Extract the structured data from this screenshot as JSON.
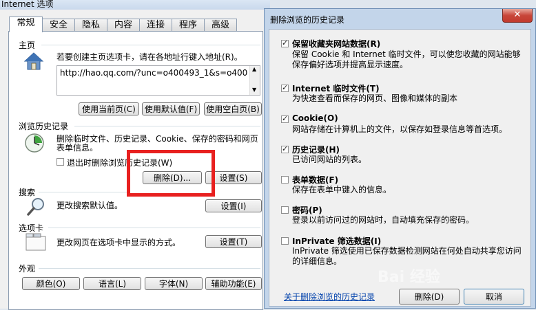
{
  "io_window": {
    "title": "Internet 选项",
    "tabs": [
      "常规",
      "安全",
      "隐私",
      "内容",
      "连接",
      "程序",
      "高级"
    ],
    "homepage": {
      "section": "主页",
      "instruction": "若要创建主页选项卡，请在各地址行键入地址(R)。",
      "url": "http://hao.qq.com/?unc=o400493_1&s=o40049",
      "buttons": [
        "使用当前页(C)",
        "使用默认值(F)",
        "使用空白页(B)"
      ]
    },
    "history": {
      "section": "浏览历史记录",
      "description_line1": "删除临时文件、历史记录、Cookie、保存的密码和网页",
      "description_line2": "表单信息。",
      "checkbox_label": "退出时删除浏览历史记录(W)",
      "delete_button": "删除(D)...",
      "settings_button": "设置(S)"
    },
    "search": {
      "section": "搜索",
      "description": "更改搜索默认值。",
      "settings_button": "设置(I)"
    },
    "tabs_section": {
      "section": "选项卡",
      "description": "更改网页在选项卡中显示的方式。",
      "settings_button": "设置(T)"
    },
    "appearance": {
      "section": "外观",
      "buttons": [
        "颜色(O)",
        "语言(L)",
        "字体(N)",
        "辅助功能(E)"
      ]
    }
  },
  "delete_dialog": {
    "title": "删除浏览的历史记录",
    "close_glyph": "✕",
    "options": [
      {
        "title": "保留收藏夹网站数据(R)",
        "desc": "保留 Cookie 和 Internet 临时文件，可以使您收藏的网站能够保存偏好选项并提高显示速度。",
        "checked": true
      },
      {
        "title": "Internet 临时文件(T)",
        "desc": "为快速查看而保存的网页、图像和媒体的副本",
        "checked": true
      },
      {
        "title": "Cookie(O)",
        "desc": "网站存储在计算机上的文件，以保存如登录信息等首选项。",
        "checked": true
      },
      {
        "title": "历史记录(H)",
        "desc": "已访问网站的列表。",
        "checked": true
      },
      {
        "title": "表单数据(F)",
        "desc": "保存在表单中键入的信息。",
        "checked": false
      },
      {
        "title": "密码(P)",
        "desc": "登录以前访问过的网站时，自动填充保存的密码。",
        "checked": false
      },
      {
        "title": "InPrivate 筛选数据(I)",
        "desc": "InPrivate 筛选使用已保存数据检测网站在何处自动共享您访问的详细信息。",
        "checked": false
      }
    ],
    "about_link": "关于删除浏览的历史记录",
    "delete_button": "删除(D)",
    "cancel_button": "取消"
  },
  "watermark": "Bai 经验",
  "colors": {
    "highlight": "#e8201f",
    "link": "#0645ad",
    "dialog_frame": "#c3d5ea",
    "close_button": "#c8463a"
  }
}
